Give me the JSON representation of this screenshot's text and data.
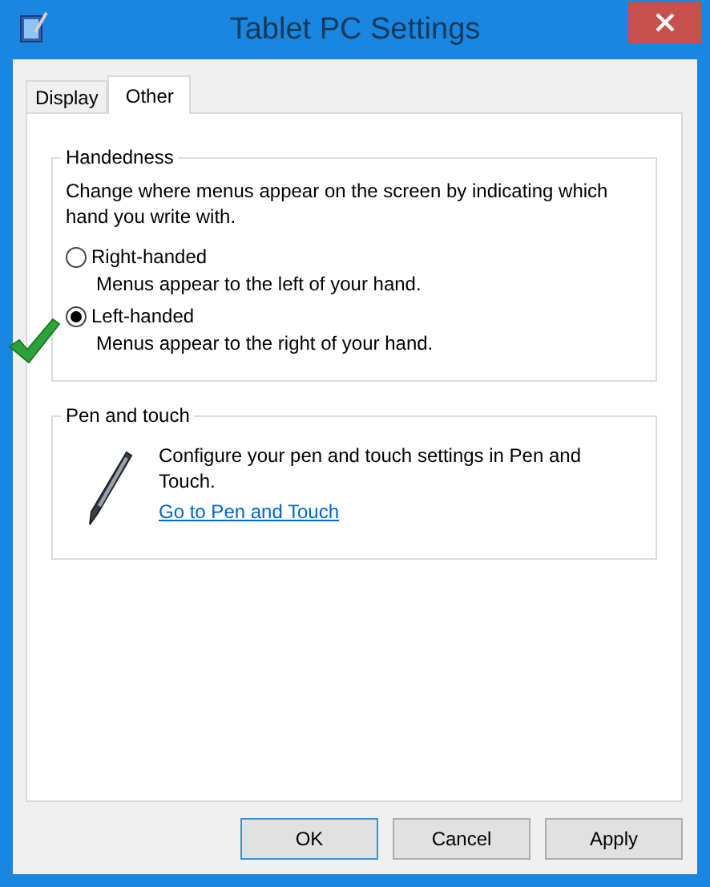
{
  "window": {
    "title": "Tablet PC Settings"
  },
  "tabs": [
    {
      "label": "Display",
      "selected": false
    },
    {
      "label": "Other",
      "selected": true
    }
  ],
  "handedness": {
    "title": "Handedness",
    "description": "Change where menus appear on the screen by indicating which hand you write with.",
    "options": [
      {
        "label": "Right-handed",
        "hint": "Menus appear to the left of your hand.",
        "selected": false
      },
      {
        "label": "Left-handed",
        "hint": "Menus appear to the right of your hand.",
        "selected": true
      }
    ]
  },
  "pen_and_touch": {
    "title": "Pen and touch",
    "description": "Configure your pen and touch settings in Pen and Touch.",
    "link": "Go to Pen and Touch"
  },
  "buttons": [
    {
      "label": "OK",
      "default": true
    },
    {
      "label": "Cancel",
      "default": false
    },
    {
      "label": "Apply",
      "default": false
    }
  ]
}
